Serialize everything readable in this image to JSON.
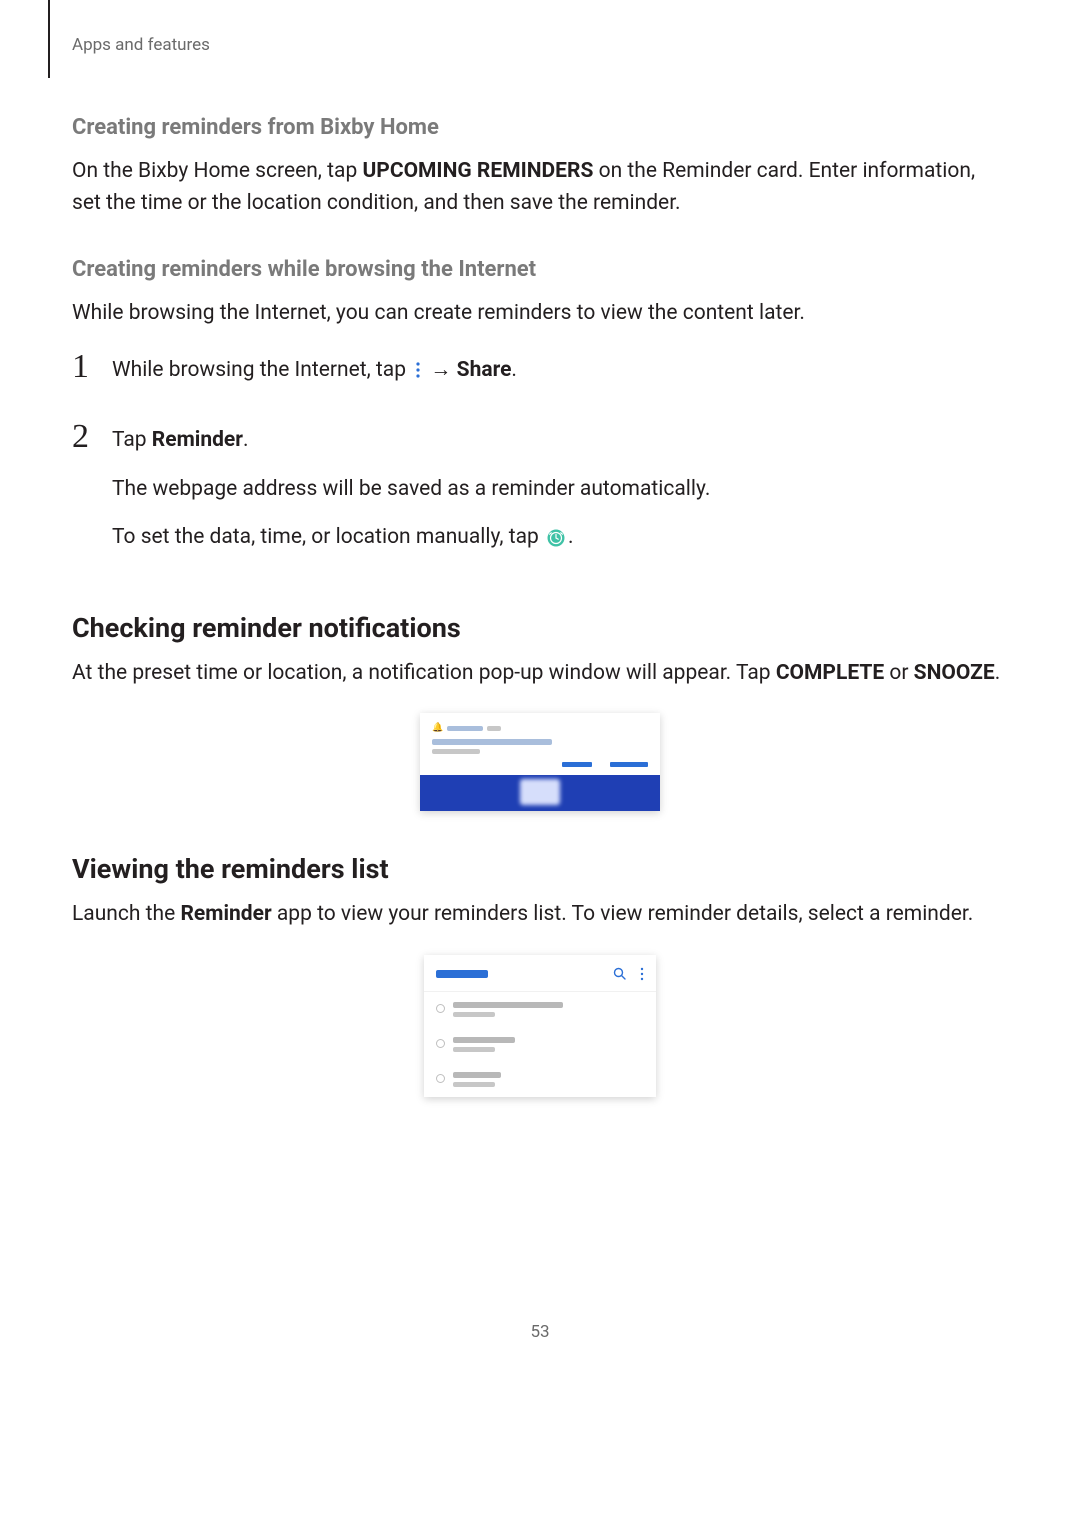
{
  "breadcrumb": "Apps and features",
  "section_bixby": {
    "heading": "Creating reminders from Bixby Home",
    "para_pre": "On the Bixby Home screen, tap ",
    "para_bold": "UPCOMING REMINDERS",
    "para_post": " on the Reminder card. Enter information, set the time or the location condition, and then save the reminder."
  },
  "section_internet": {
    "heading": "Creating reminders while browsing the Internet",
    "para": "While browsing the Internet, you can create reminders to view the content later.",
    "steps": [
      {
        "num": "1",
        "pre": "While browsing the Internet, tap ",
        "arrow": " → ",
        "bold": "Share",
        "post": "."
      },
      {
        "num": "2",
        "line1_pre": "Tap ",
        "line1_bold": "Reminder",
        "line1_post": ".",
        "line2": "The webpage address will be saved as a reminder automatically.",
        "line3_pre": "To set the data, time, or location manually, tap ",
        "line3_post": "."
      }
    ]
  },
  "section_checking": {
    "heading": "Checking reminder notifications",
    "para_pre": "At the preset time or location, a notification pop-up window will appear. Tap ",
    "para_bold1": "COMPLETE",
    "para_mid": " or ",
    "para_bold2": "SNOOZE",
    "para_post": "."
  },
  "section_viewing": {
    "heading": "Viewing the reminders list",
    "para_pre": "Launch the ",
    "para_bold": "Reminder",
    "para_post": " app to view your reminders list. To view reminder details, select a reminder."
  },
  "page_number": "53"
}
